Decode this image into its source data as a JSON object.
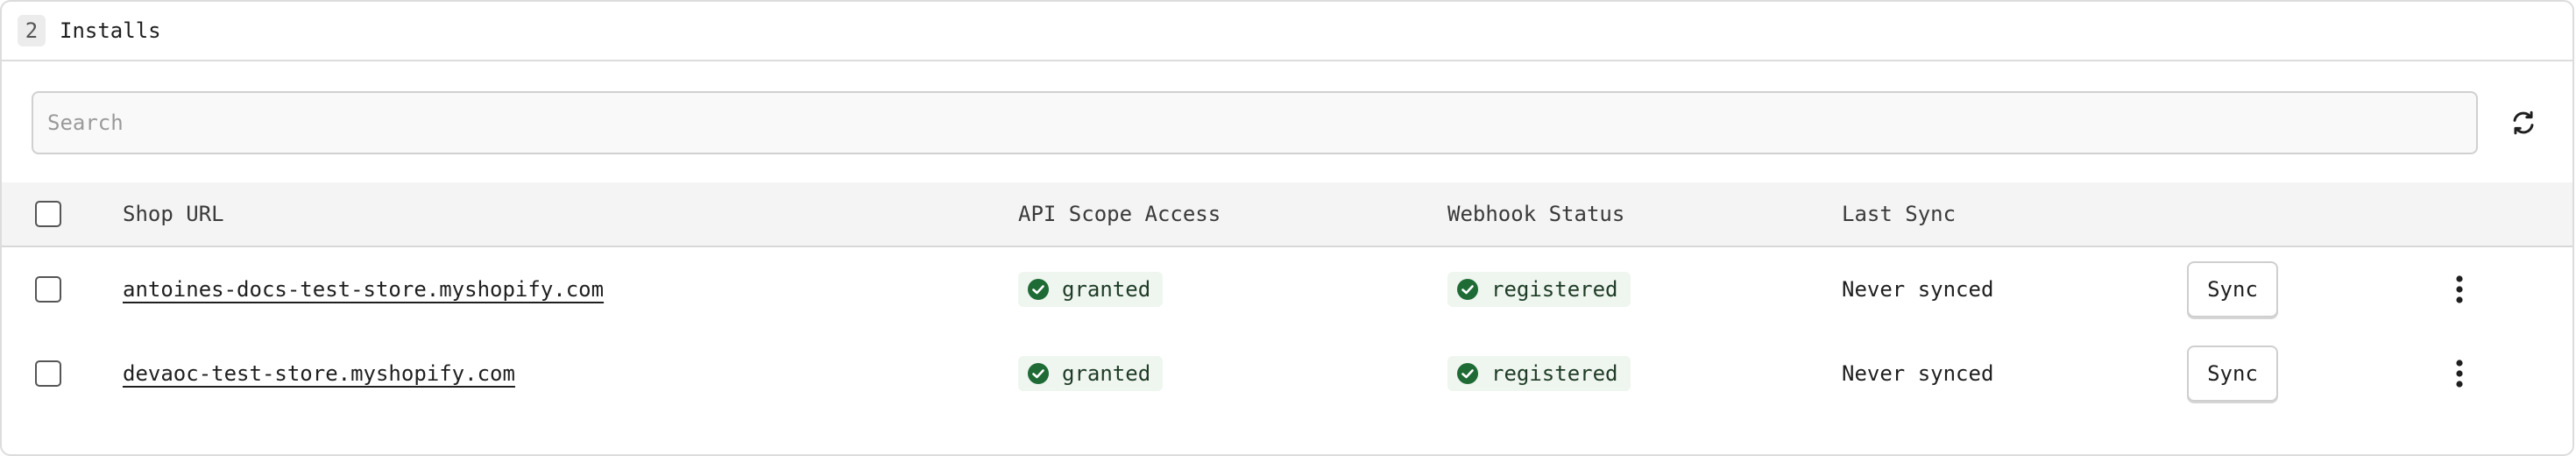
{
  "header": {
    "count": "2",
    "title": "Installs"
  },
  "search": {
    "placeholder": "Search",
    "value": ""
  },
  "table": {
    "columns": {
      "shop_url": "Shop URL",
      "api_scope": "API Scope Access",
      "webhook": "Webhook Status",
      "last_sync": "Last Sync"
    },
    "rows": [
      {
        "shop_url": "antoines-docs-test-store.myshopify.com",
        "api_scope": "granted",
        "webhook": "registered",
        "last_sync": "Never synced",
        "action": "Sync"
      },
      {
        "shop_url": "devaoc-test-store.myshopify.com",
        "api_scope": "granted",
        "webhook": "registered",
        "last_sync": "Never synced",
        "action": "Sync"
      }
    ]
  },
  "icons": {
    "refresh": "refresh-icon",
    "status": "check-circle-icon",
    "more": "kebab-menu-icon"
  },
  "colors": {
    "status_green": "#1e6b35",
    "status_bg": "#eef6ef"
  }
}
